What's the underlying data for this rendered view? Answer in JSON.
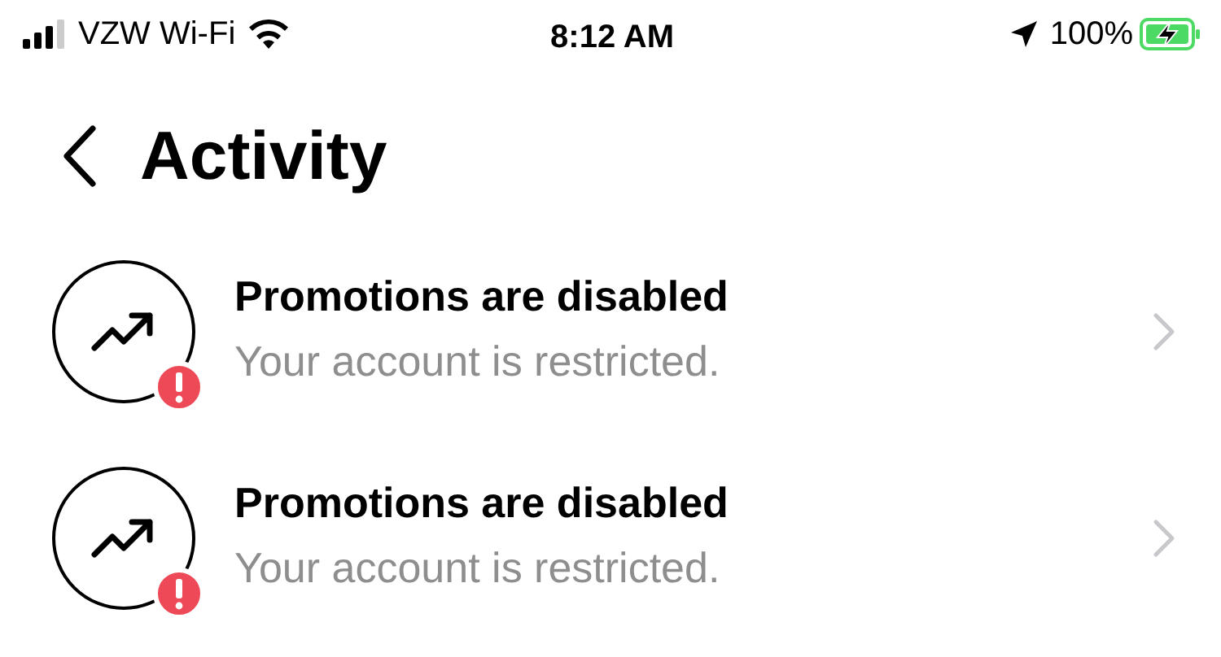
{
  "status_bar": {
    "carrier": "VZW Wi-Fi",
    "time": "8:12 AM",
    "battery": "100%",
    "charging": true
  },
  "header": {
    "title": "Activity"
  },
  "rows": [
    {
      "title": "Promotions are disabled",
      "subtitle": "Your account is restricted.",
      "alert": true
    },
    {
      "title": "Promotions are disabled",
      "subtitle": "Your account is restricted.",
      "alert": true
    }
  ]
}
